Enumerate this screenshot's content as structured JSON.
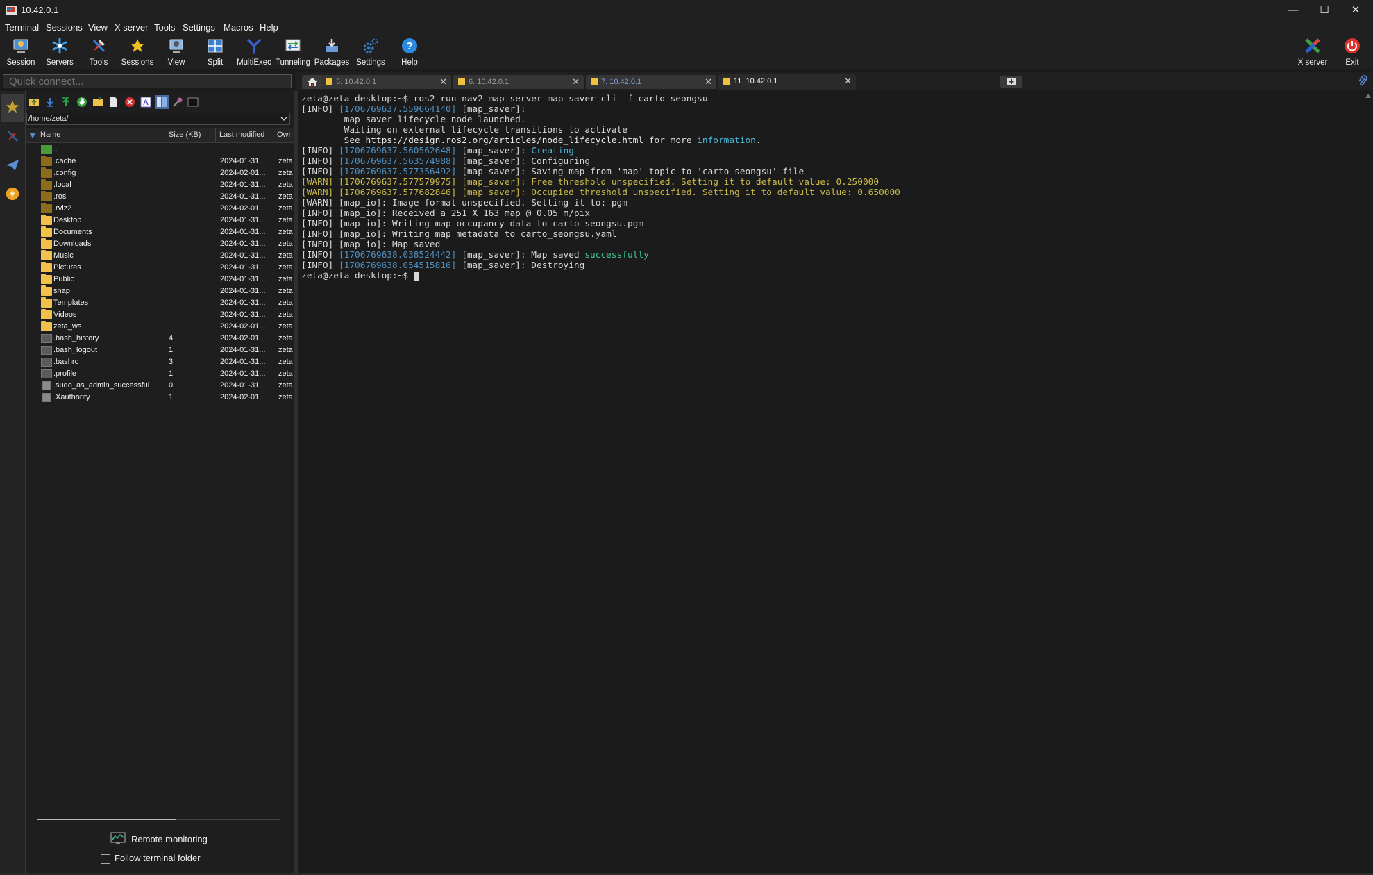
{
  "window": {
    "title": "10.42.0.1",
    "controls": {
      "minimize": "—",
      "maximize": "☐",
      "close": "✕"
    }
  },
  "menu": [
    "Terminal",
    "Sessions",
    "View",
    "X server",
    "Tools",
    "Settings",
    "Macros",
    "Help"
  ],
  "toolbar": {
    "items": [
      "Session",
      "Servers",
      "Tools",
      "Sessions",
      "View",
      "Split",
      "MultiExec",
      "Tunneling",
      "Packages",
      "Settings",
      "Help"
    ],
    "right_items": [
      "X server",
      "Exit"
    ]
  },
  "quick_connect": {
    "placeholder": "Quick connect..."
  },
  "sftp": {
    "path": "/home/zeta/",
    "columns": [
      "Name",
      "Size (KB)",
      "Last modified",
      "Owr"
    ],
    "files": [
      {
        "name": "..",
        "size": "",
        "date": "",
        "owner": "",
        "kind": "up"
      },
      {
        "name": ".cache",
        "size": "",
        "date": "2024-01-31...",
        "owner": "zeta",
        "kind": "hidden-folder"
      },
      {
        "name": ".config",
        "size": "",
        "date": "2024-02-01...",
        "owner": "zeta",
        "kind": "hidden-folder"
      },
      {
        "name": ".local",
        "size": "",
        "date": "2024-01-31...",
        "owner": "zeta",
        "kind": "hidden-folder"
      },
      {
        "name": ".ros",
        "size": "",
        "date": "2024-01-31...",
        "owner": "zeta",
        "kind": "hidden-folder"
      },
      {
        "name": ".rviz2",
        "size": "",
        "date": "2024-02-01...",
        "owner": "zeta",
        "kind": "hidden-folder"
      },
      {
        "name": "Desktop",
        "size": "",
        "date": "2024-01-31...",
        "owner": "zeta",
        "kind": "folder"
      },
      {
        "name": "Documents",
        "size": "",
        "date": "2024-01-31...",
        "owner": "zeta",
        "kind": "folder"
      },
      {
        "name": "Downloads",
        "size": "",
        "date": "2024-01-31...",
        "owner": "zeta",
        "kind": "folder"
      },
      {
        "name": "Music",
        "size": "",
        "date": "2024-01-31...",
        "owner": "zeta",
        "kind": "folder"
      },
      {
        "name": "Pictures",
        "size": "",
        "date": "2024-01-31...",
        "owner": "zeta",
        "kind": "folder"
      },
      {
        "name": "Public",
        "size": "",
        "date": "2024-01-31...",
        "owner": "zeta",
        "kind": "folder"
      },
      {
        "name": "snap",
        "size": "",
        "date": "2024-01-31...",
        "owner": "zeta",
        "kind": "folder"
      },
      {
        "name": "Templates",
        "size": "",
        "date": "2024-01-31...",
        "owner": "zeta",
        "kind": "folder"
      },
      {
        "name": "Videos",
        "size": "",
        "date": "2024-01-31...",
        "owner": "zeta",
        "kind": "folder"
      },
      {
        "name": "zeta_ws",
        "size": "",
        "date": "2024-02-01...",
        "owner": "zeta",
        "kind": "folder"
      },
      {
        "name": ".bash_history",
        "size": "4",
        "date": "2024-02-01...",
        "owner": "zeta",
        "kind": "file"
      },
      {
        "name": ".bash_logout",
        "size": "1",
        "date": "2024-01-31...",
        "owner": "zeta",
        "kind": "file"
      },
      {
        "name": ".bashrc",
        "size": "3",
        "date": "2024-01-31...",
        "owner": "zeta",
        "kind": "file"
      },
      {
        "name": ".profile",
        "size": "1",
        "date": "2024-01-31...",
        "owner": "zeta",
        "kind": "file"
      },
      {
        "name": ".sudo_as_admin_successful",
        "size": "0",
        "date": "2024-01-31...",
        "owner": "zeta",
        "kind": "doc"
      },
      {
        "name": ".Xauthority",
        "size": "1",
        "date": "2024-02-01...",
        "owner": "zeta",
        "kind": "doc"
      }
    ],
    "remote_monitoring": "Remote monitoring",
    "follow_folder": "Follow terminal folder"
  },
  "tabs": [
    {
      "label": "5. 10.42.0.1",
      "active": false,
      "blue": false
    },
    {
      "label": "6. 10.42.0.1",
      "active": false,
      "blue": false
    },
    {
      "label": "7. 10.42.0.1",
      "active": false,
      "blue": true
    },
    {
      "label": "11. 10.42.0.1",
      "active": true,
      "blue": false
    }
  ],
  "terminal": {
    "lines": [
      [
        {
          "t": "zeta@zeta-desktop:~$ ros2 run nav2_map_server map_saver_cli -f carto_seongsu",
          "c": "info"
        }
      ],
      [
        {
          "t": "[INFO] ",
          "c": "info"
        },
        {
          "t": "[1706769637.559664140]",
          "c": "ts"
        },
        {
          "t": " [map_saver]:",
          "c": "info"
        }
      ],
      [
        {
          "t": "        map_saver lifecycle node launched.",
          "c": "info"
        }
      ],
      [
        {
          "t": "        Waiting on external lifecycle transitions to activate",
          "c": "info"
        }
      ],
      [
        {
          "t": "        See ",
          "c": "info"
        },
        {
          "t": "https://design.ros2.org/articles/node_lifecycle.html",
          "c": "link"
        },
        {
          "t": " for more ",
          "c": "info"
        },
        {
          "t": "information",
          "c": "cyan"
        },
        {
          "t": ".",
          "c": "info"
        }
      ],
      [
        {
          "t": "[INFO] ",
          "c": "info"
        },
        {
          "t": "[1706769637.560562648]",
          "c": "ts"
        },
        {
          "t": " [map_saver]: ",
          "c": "info"
        },
        {
          "t": "Creating",
          "c": "cyan"
        }
      ],
      [
        {
          "t": "[INFO] ",
          "c": "info"
        },
        {
          "t": "[1706769637.563574988]",
          "c": "ts"
        },
        {
          "t": " [map_saver]: Configuring",
          "c": "info"
        }
      ],
      [
        {
          "t": "[INFO] ",
          "c": "info"
        },
        {
          "t": "[1706769637.577356492]",
          "c": "ts"
        },
        {
          "t": " [map_saver]: Saving map from 'map' topic to 'carto_seongsu' file",
          "c": "info"
        }
      ],
      [
        {
          "t": "[WARN] [1706769637.577579975] [map_saver]: Free threshold unspecified. Setting it to default value: 0.250000",
          "c": "warn"
        }
      ],
      [
        {
          "t": "[WARN] [1706769637.577682846] [map_saver]: Occupied threshold unspecified. Setting it to default value: 0.650000",
          "c": "warn"
        }
      ],
      [
        {
          "t": "[WARN] [map_io]: Image format unspecified. Setting it to: pgm",
          "c": "info"
        }
      ],
      [
        {
          "t": "[INFO] [map_io]: Received a 251 X 163 map @ 0.05 m/pix",
          "c": "info"
        }
      ],
      [
        {
          "t": "[INFO] [map_io]: Writing map occupancy data to carto_seongsu.pgm",
          "c": "info"
        }
      ],
      [
        {
          "t": "[INFO] [map_io]: Writing map metadata to carto_seongsu.yaml",
          "c": "info"
        }
      ],
      [
        {
          "t": "[INFO] [map_io]: Map saved",
          "c": "info"
        }
      ],
      [
        {
          "t": "[INFO] ",
          "c": "info"
        },
        {
          "t": "[1706769638.038524442]",
          "c": "ts"
        },
        {
          "t": " [map_saver]: Map saved ",
          "c": "info"
        },
        {
          "t": "successfully",
          "c": "green"
        }
      ],
      [
        {
          "t": "[INFO] ",
          "c": "info"
        },
        {
          "t": "[1706769638.054515816]",
          "c": "ts"
        },
        {
          "t": " [map_saver]: Destroying",
          "c": "info"
        }
      ],
      [
        {
          "t": "zeta@zeta-desktop:~$ ",
          "c": "info"
        },
        {
          "t": "",
          "c": "cursor"
        }
      ]
    ]
  },
  "icons": {
    "toolbar": [
      "session-icon",
      "servers-icon",
      "tools-icon",
      "sessions-star-icon",
      "view-icon",
      "split-icon",
      "multiexec-icon",
      "tunneling-icon",
      "packages-icon",
      "settings-gear-icon",
      "help-icon"
    ],
    "sftp_toolbar": [
      "folder-up-icon",
      "download-icon",
      "upload-icon",
      "refresh-icon",
      "new-folder-icon",
      "new-file-icon",
      "delete-icon",
      "rename-icon",
      "toggle-view-icon",
      "properties-icon",
      "terminal-icon"
    ]
  },
  "colors": {
    "folder": "#f2c14b",
    "timestamp": "#4f8fbf",
    "warn": "#c9b84a",
    "success": "#3cc58a",
    "exit": "#e0302a",
    "help": "#2b8ae0"
  }
}
